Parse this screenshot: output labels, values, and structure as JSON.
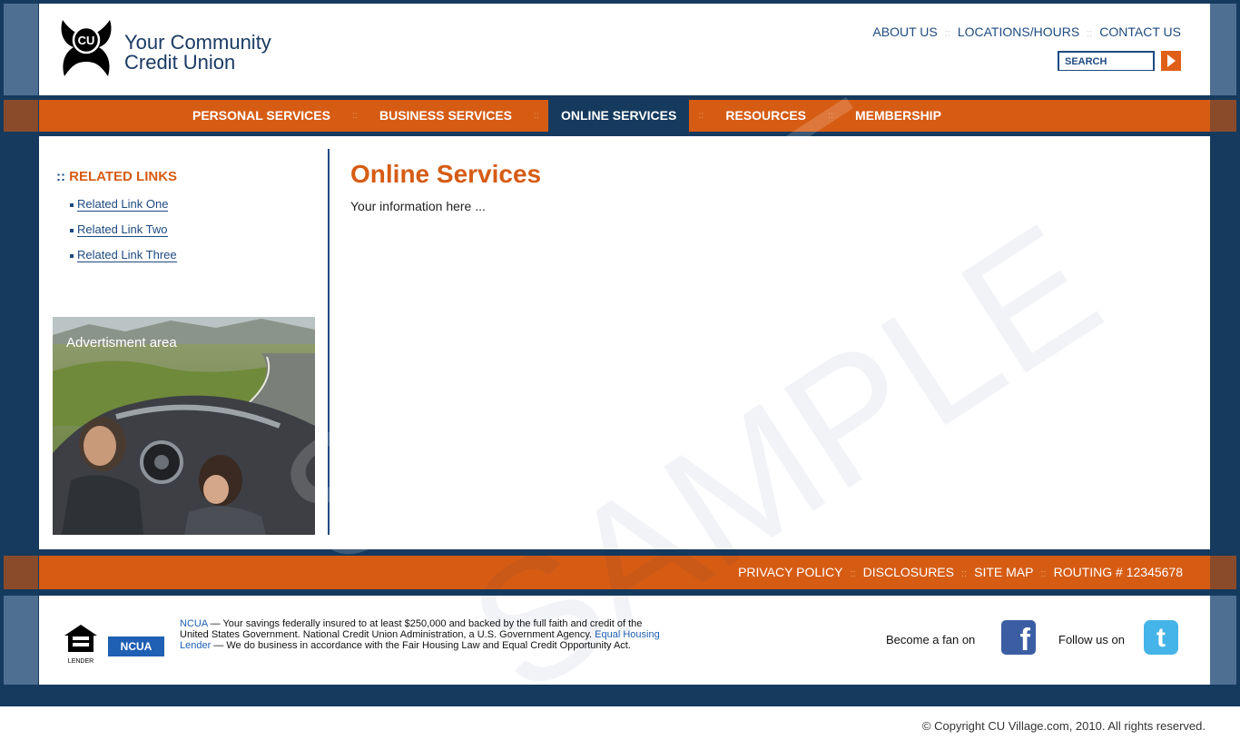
{
  "header": {
    "logo_top": "Your Community",
    "logo_bottom": "Credit Union",
    "logo_badge": "CU",
    "top_links": [
      "ABOUT US",
      "LOCATIONS/HOURS",
      "CONTACT US"
    ],
    "search_placeholder": "SEARCH"
  },
  "nav": {
    "items": [
      "PERSONAL SERVICES",
      "BUSINESS SERVICES",
      "ONLINE SERVICES",
      "RESOURCES",
      "MEMBERSHIP"
    ],
    "active": "ONLINE SERVICES",
    "separator": "::"
  },
  "sidebar": {
    "title_prefix": "::",
    "title": "RELATED LINKS",
    "links": [
      "Related Link One",
      "Related Link Two",
      "Related Link Three"
    ],
    "ad_label": "Advertisment area"
  },
  "main": {
    "title": "Online Services",
    "body": "Your information here ..."
  },
  "footer_bar": {
    "links": [
      "PRIVACY POLICY",
      "DISCLOSURES",
      "SITE MAP",
      "ROUTING # 12345678"
    ]
  },
  "bottom": {
    "eho_label": "LENDER",
    "ncua_badge": "NCUA",
    "disclaimer_ncua": "NCUA",
    "disclaimer_part1": " — Your savings federally insured to at least $250,000 and backed by the full faith and credit of the United States Government. National Credit Union Administration, a U.S. Government Agency. ",
    "disclaimer_ehl": "Equal Housing Lender",
    "disclaimer_part2": " — We do business in accordance with the Fair Housing Law and Equal Credit Opportunity Act.",
    "fan_text": "Become a fan on",
    "follow_text": "Follow us on",
    "facebook_glyph": "f",
    "twitter_glyph": "t"
  },
  "copyright": "© Copyright CU Village.com, 2010. All rights reserved.",
  "watermark": "SAMPLE",
  "colors": {
    "navy": "#153a5e",
    "orange": "#d65c14",
    "link_blue": "#1d4a80"
  }
}
